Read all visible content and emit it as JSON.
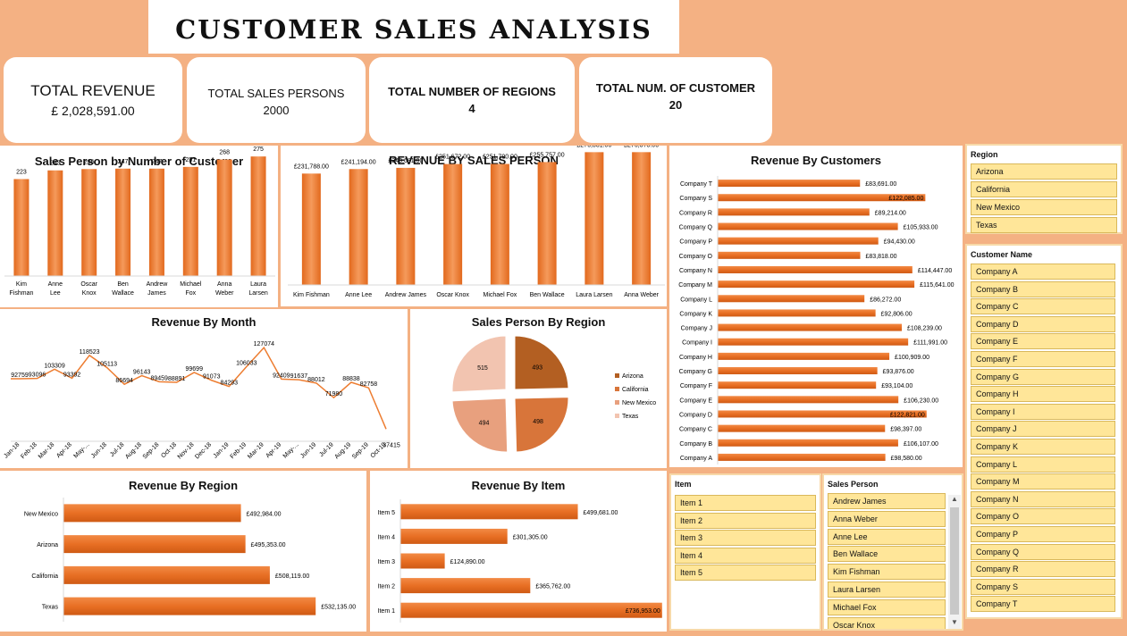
{
  "title": "CUSTOMER SALES ANALYSIS",
  "kpis": {
    "revenue_label": "TOTAL REVENUE",
    "revenue_value": "£  2,028,591.00",
    "persons_label": "TOTAL SALES PERSONS",
    "persons_value": "2000",
    "regions_label": "TOTAL NUMBER OF REGIONS",
    "regions_value": "4",
    "customers_label": "TOTAL NUM. OF CUSTOMER",
    "customers_value": "20"
  },
  "colors": {
    "accent": "#ed7d31",
    "background": "#f4b183",
    "slicer_item": "#ffe699"
  },
  "chart_data": [
    {
      "id": "cust_count",
      "type": "bar",
      "title": "Sales Person by Number of Customer",
      "categories": [
        "Kim Fishman",
        "Anne Lee",
        "Oscar Knox",
        "Ben Wallace",
        "Andrew James",
        "Michael Fox",
        "Anna Weber",
        "Laura Larsen"
      ],
      "values": [
        223,
        243,
        246,
        247,
        247,
        251,
        268,
        275
      ],
      "labels": [
        "223",
        "243",
        "246",
        "247",
        "247",
        "251",
        "268",
        "275"
      ],
      "ylim": [
        0,
        300
      ]
    },
    {
      "id": "rev_person",
      "type": "bar",
      "title": "REVENUE BY SALES PERSON",
      "categories": [
        "Kim Fishman",
        "Anne Lee",
        "Andrew James",
        "Oscar Knox",
        "Michael Fox",
        "Ben Wallace",
        "Laura Larsen",
        "Anna Weber"
      ],
      "values": [
        231788,
        241194,
        243681,
        251672,
        251790,
        255757,
        276331,
        276378
      ],
      "labels": [
        "£231,788.00",
        "£241,194.00",
        "£243,681.00",
        "£251,672.00",
        "£251,790.00",
        "£255,757.00",
        "£276,331.00",
        "£276,378.00"
      ],
      "ylim": [
        0,
        290000
      ]
    },
    {
      "id": "rev_customer",
      "type": "bar",
      "orientation": "horizontal",
      "title": "Revenue By Customers",
      "categories": [
        "Company T",
        "Company S",
        "Company R",
        "Company Q",
        "Company P",
        "Company O",
        "Company N",
        "Company M",
        "Company L",
        "Company K",
        "Company J",
        "Company I",
        "Company H",
        "Company G",
        "Company F",
        "Company E",
        "Company D",
        "Company C",
        "Company B",
        "Company A"
      ],
      "values": [
        83691,
        122085,
        89214,
        105933,
        94430,
        83818,
        114447,
        115641,
        86272,
        92806,
        108239,
        111991,
        100909,
        93876,
        93104,
        106230,
        122821,
        98397,
        106107,
        98580
      ],
      "labels": [
        "£83,691.00",
        "£122,085.00",
        "£89,214.00",
        "£105,933.00",
        "£94,430.00",
        "£83,818.00",
        "£114,447.00",
        "£115,641.00",
        "£86,272.00",
        "£92,806.00",
        "£108,239.00",
        "£111,991.00",
        "£100,909.00",
        "£93,876.00",
        "£93,104.00",
        "£106,230.00",
        "£122,821.00",
        "£98,397.00",
        "£106,107.00",
        "£98,580.00"
      ],
      "xlim": [
        0,
        124000
      ]
    },
    {
      "id": "rev_month",
      "type": "line",
      "title": "Revenue By Month",
      "x": [
        "Jan-18",
        "Feb-18",
        "Mar-18",
        "Apr-18",
        "May-...",
        "Jun-18",
        "Jul-18",
        "Aug-18",
        "Sep-18",
        "Oct-18",
        "Nov-18",
        "Dec-18",
        "Jan-19",
        "Feb-19",
        "Mar-19",
        "Apr-19",
        "May-...",
        "Jun-19",
        "Jul-19",
        "Aug-19",
        "Sep-19",
        "Oct-19"
      ],
      "values": [
        92759,
        93096,
        103309,
        93392,
        118523,
        105113,
        86694,
        96143,
        89459,
        88891,
        99699,
        91073,
        84293,
        106033,
        127074,
        92409,
        91637,
        88012,
        71980,
        88838,
        82758,
        37415
      ],
      "labels": [
        "92759",
        "93096",
        "103309",
        "93392",
        "118523",
        "105113",
        "86694",
        "96143",
        "89459",
        "88891",
        "99699",
        "91073",
        "84293",
        "106033",
        "127074",
        "92409",
        "91637",
        "88012",
        "71980",
        "88838",
        "82758",
        "37415"
      ],
      "ylim": [
        20000,
        140000
      ]
    },
    {
      "id": "region_pie",
      "type": "pie",
      "title": "Sales Person By Region",
      "categories": [
        "Arizona",
        "California",
        "New Mexico",
        "Texas"
      ],
      "values": [
        493,
        498,
        494,
        515
      ],
      "labels": [
        "493",
        "498",
        "494",
        "515"
      ],
      "colors": [
        "#b35f22",
        "#d8753a",
        "#e8a07e",
        "#f2c4b0"
      ],
      "legend": "right"
    },
    {
      "id": "rev_region",
      "type": "bar",
      "orientation": "horizontal",
      "title": "Revenue By Region",
      "categories": [
        "New Mexico",
        "Arizona",
        "California",
        "Texas"
      ],
      "values": [
        492984,
        495353,
        508119,
        532135
      ],
      "labels": [
        "£492,984.00",
        "£495,353.00",
        "£508,119.00",
        "£532,135.00"
      ],
      "xlim": [
        400000,
        540000
      ]
    },
    {
      "id": "rev_item",
      "type": "bar",
      "orientation": "horizontal",
      "title": "Revenue By Item",
      "categories": [
        "Item 5",
        "Item 4",
        "Item 3",
        "Item 2",
        "Item 1"
      ],
      "values": [
        499681,
        301305,
        124890,
        365762,
        736953
      ],
      "labels": [
        "£499,681.00",
        "£301,305.00",
        "£124,890.00",
        "£365,762.00",
        "£736,953.00"
      ],
      "xlim": [
        0,
        740000
      ]
    }
  ],
  "slicers": {
    "region": {
      "header": "Region",
      "items": [
        "Arizona",
        "California",
        "New Mexico",
        "Texas"
      ]
    },
    "customer": {
      "header": "Customer Name",
      "items": [
        "Company A",
        "Company B",
        "Company C",
        "Company D",
        "Company E",
        "Company F",
        "Company G",
        "Company H",
        "Company I",
        "Company J",
        "Company K",
        "Company L",
        "Company M",
        "Company N",
        "Company O",
        "Company P",
        "Company Q",
        "Company R",
        "Company S",
        "Company T"
      ]
    },
    "item": {
      "header": "Item",
      "items": [
        "Item 1",
        "Item 2",
        "Item 3",
        "Item 4",
        "Item 5"
      ]
    },
    "salesperson": {
      "header": "Sales Person",
      "items": [
        "Andrew James",
        "Anna Weber",
        "Anne Lee",
        "Ben Wallace",
        "Kim Fishman",
        "Laura Larsen",
        "Michael Fox",
        "Oscar Knox"
      ]
    }
  }
}
